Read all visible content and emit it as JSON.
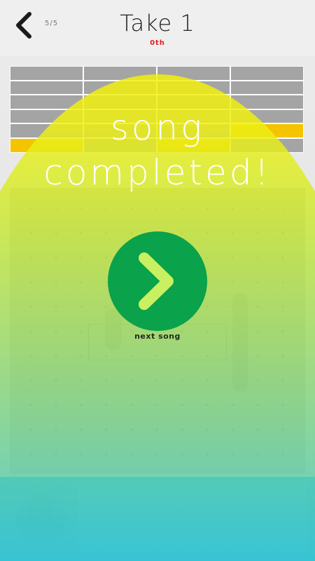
{
  "header": {
    "back_icon": "chevron-left-icon",
    "progress": "5/5",
    "title": "Take 1",
    "rank": "0th"
  },
  "tracks": {
    "rows": 6,
    "columns": 4,
    "active_cells": [
      [
        5,
        0
      ],
      [
        5,
        2
      ],
      [
        4,
        3
      ]
    ]
  },
  "overlay": {
    "message_line1": "song",
    "message_line2": "completed!",
    "next_label": "next song",
    "next_icon": "chevron-right-icon"
  },
  "colors": {
    "overlay_top": "#f6f000",
    "overlay_bottom": "#32c4d7",
    "next_button": "#0aa24a",
    "rank": "#e02020",
    "active_cell": "#f4c400"
  },
  "controls": {
    "stop_icon": "stop-icon"
  }
}
